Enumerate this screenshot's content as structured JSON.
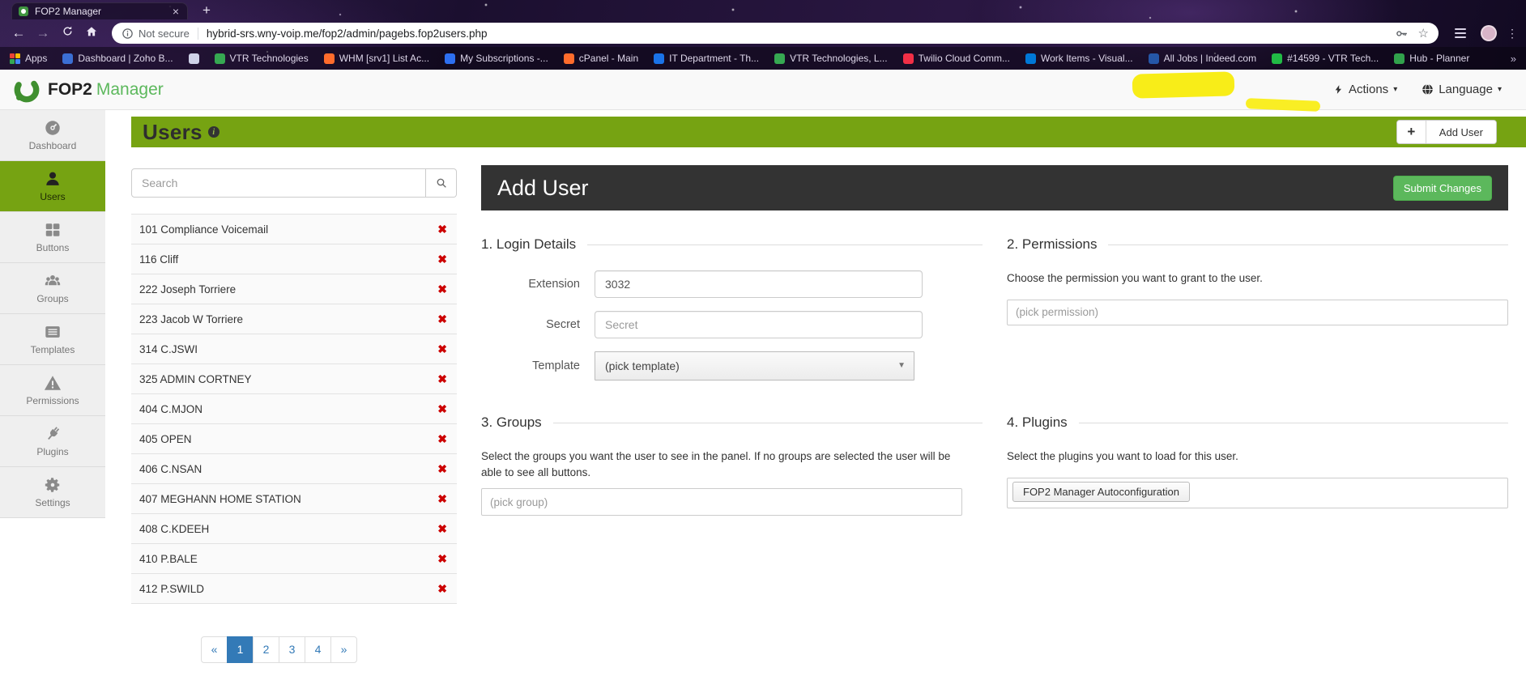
{
  "browser": {
    "tab_title": "FOP2 Manager",
    "close_tab_glyph": "×",
    "new_tab_glyph": "+",
    "security_label": "Not secure",
    "url": "hybrid-srs.wny-voip.me/fop2/admin/pagebs.fop2users.php",
    "overflow_chevron": "»",
    "bookmarks": [
      {
        "label": "Apps",
        "icon": "apps-grid-icon",
        "color": "#4285f4"
      },
      {
        "label": "Dashboard | Zoho B...",
        "icon": "zoho-favicon",
        "color": "#3b6fd4"
      },
      {
        "label": "",
        "icon": "rocket-favicon",
        "color": "#cfd2e8"
      },
      {
        "label": "VTR Technologies",
        "icon": "vtr-favicon",
        "color": "#36a852"
      },
      {
        "label": "WHM [srv1] List Ac...",
        "icon": "whm-favicon",
        "color": "#ff6c2c"
      },
      {
        "label": "My Subscriptions -...",
        "icon": "subscriptions-favicon",
        "color": "#2d6ff0"
      },
      {
        "label": "cPanel - Main",
        "icon": "cpanel-favicon",
        "color": "#ff6c2c"
      },
      {
        "label": "IT Department - Th...",
        "icon": "it-dept-favicon",
        "color": "#1a73e8"
      },
      {
        "label": "VTR Technologies, L...",
        "icon": "vtr-favicon",
        "color": "#36a852"
      },
      {
        "label": "Twilio Cloud Comm...",
        "icon": "twilio-favicon",
        "color": "#f22f46"
      },
      {
        "label": "Work Items - Visual...",
        "icon": "azure-favicon",
        "color": "#0078d7"
      },
      {
        "label": "All Jobs | Indeed.com",
        "icon": "indeed-favicon",
        "color": "#2557a7"
      },
      {
        "label": "#14599 - VTR Tech...",
        "icon": "ticket-favicon",
        "color": "#21ba45"
      },
      {
        "label": "Hub - Planner",
        "icon": "planner-favicon",
        "color": "#31a24c"
      }
    ]
  },
  "header": {
    "logo_bold": "FOP2",
    "logo_light": "Manager",
    "actions_label": "Actions",
    "language_label": "Language",
    "caret": "▾"
  },
  "sidebar": {
    "items": [
      {
        "label": "Dashboard",
        "icon": "dashboard",
        "active": false
      },
      {
        "label": "Users",
        "icon": "users",
        "active": true
      },
      {
        "label": "Buttons",
        "icon": "buttons",
        "active": false
      },
      {
        "label": "Groups",
        "icon": "groups",
        "active": false
      },
      {
        "label": "Templates",
        "icon": "templates",
        "active": false
      },
      {
        "label": "Permissions",
        "icon": "permissions",
        "active": false
      },
      {
        "label": "Plugins",
        "icon": "plugins",
        "active": false
      },
      {
        "label": "Settings",
        "icon": "settings",
        "active": false
      }
    ]
  },
  "users_panel": {
    "title": "Users",
    "plus_button": "+",
    "add_user_button": "Add User",
    "search_placeholder": "Search",
    "delete_glyph": "✖",
    "users": [
      "101 Compliance Voicemail",
      "116 Cliff",
      "222 Joseph Torriere",
      "223 Jacob W Torriere",
      "314 C.JSWI",
      "325 ADMIN CORTNEY",
      "404 C.MJON",
      "405 OPEN",
      "406 C.NSAN",
      "407 MEGHANN HOME STATION",
      "408 C.KDEEH",
      "410 P.BALE",
      "412 P.SWILD"
    ],
    "pagination": {
      "prev": "«",
      "pages": [
        "1",
        "2",
        "3",
        "4"
      ],
      "active_page": "1",
      "next": "»"
    }
  },
  "form": {
    "title": "Add User",
    "submit_button": "Submit Changes",
    "login": {
      "heading": "1. Login Details",
      "extension_label": "Extension",
      "extension_value": "3032",
      "secret_label": "Secret",
      "secret_placeholder": "Secret",
      "template_label": "Template",
      "template_value": "(pick template)"
    },
    "permissions": {
      "heading": "2. Permissions",
      "help": "Choose the permission you want to grant to the user.",
      "placeholder": "(pick permission)"
    },
    "groups": {
      "heading": "3. Groups",
      "help": "Select the groups you want the user to see in the panel. If no groups are selected the user will be able to see all buttons.",
      "placeholder": "(pick group)"
    },
    "plugins": {
      "heading": "4. Plugins",
      "help": "Select the plugins you want to load for this user.",
      "selected_plugin": "FOP2 Manager Autoconfiguration"
    }
  },
  "colors": {
    "accent_green": "#76a312",
    "brand_green": "#5cb85c",
    "header_dark": "#333333",
    "pagination_active": "#337ab7",
    "delete_red": "#cc0000",
    "highlight_yellow": "#f8ec0c"
  }
}
